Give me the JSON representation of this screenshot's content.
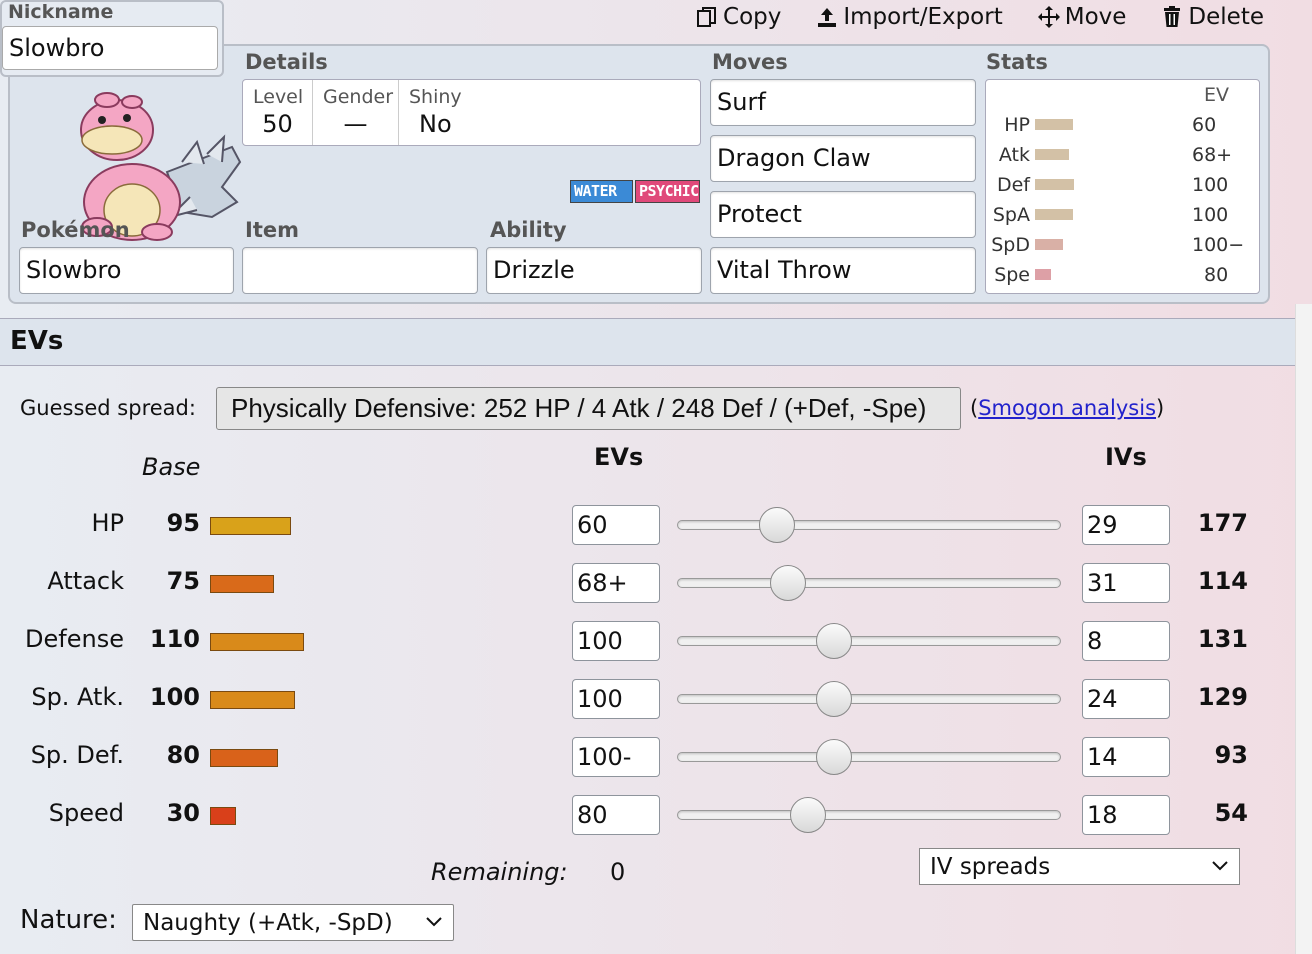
{
  "toolbar": {
    "copy": "Copy",
    "import_export": "Import/Export",
    "move": "Move",
    "delete": "Delete"
  },
  "nickname": {
    "label": "Nickname",
    "value": "Slowbro"
  },
  "sections": {
    "details": "Details",
    "moves": "Moves",
    "stats": "Stats",
    "pokemon": "Pokémon",
    "item": "Item",
    "ability": "Ability"
  },
  "details": {
    "level_label": "Level",
    "level": "50",
    "gender_label": "Gender",
    "gender": "—",
    "shiny_label": "Shiny",
    "shiny": "No"
  },
  "types": [
    "WATER",
    "PSYCHIC"
  ],
  "pokemon": "Slowbro",
  "item": "",
  "ability": "Drizzle",
  "moves": [
    "Surf",
    "Dragon Claw",
    "Protect",
    "Vital Throw"
  ],
  "stats_panel": {
    "ev_header": "EV",
    "rows": [
      {
        "name": "HP",
        "ev": "60"
      },
      {
        "name": "Atk",
        "ev": "68+"
      },
      {
        "name": "Def",
        "ev": "100"
      },
      {
        "name": "SpA",
        "ev": "100"
      },
      {
        "name": "SpD",
        "ev": "100−"
      },
      {
        "name": "Spe",
        "ev": "80"
      }
    ]
  },
  "evs_section": {
    "title": "EVs",
    "guessed_label": "Guessed spread:",
    "guessed_value": "Physically Defensive: 252 HP / 4 Atk / 248 Def / (+Def, -Spe)",
    "smogon_link": "Smogon analysis",
    "base_header": "Base",
    "evs_header": "EVs",
    "ivs_header": "IVs",
    "remaining_label": "Remaining:",
    "remaining_value": "0",
    "iv_spreads": "IV spreads",
    "nature_label": "Nature:",
    "nature_value": "Naughty (+Atk, -SpD)"
  },
  "stat_rows": [
    {
      "name": "HP",
      "base": "95",
      "ev": "60",
      "iv": "29",
      "total": "177",
      "bar_color": "#d9a21a",
      "slider_fraction": 0.26
    },
    {
      "name": "Attack",
      "base": "75",
      "ev": "68+",
      "iv": "31",
      "total": "114",
      "bar_color": "#d96a1a",
      "slider_fraction": 0.29
    },
    {
      "name": "Defense",
      "base": "110",
      "ev": "100",
      "iv": "8",
      "total": "131",
      "bar_color": "#d98a1a",
      "slider_fraction": 0.41
    },
    {
      "name": "Sp. Atk.",
      "base": "100",
      "ev": "100",
      "iv": "24",
      "total": "129",
      "bar_color": "#d98a1a",
      "slider_fraction": 0.41
    },
    {
      "name": "Sp. Def.",
      "base": "80",
      "ev": "100-",
      "iv": "14",
      "total": "93",
      "bar_color": "#d9621a",
      "slider_fraction": 0.41
    },
    {
      "name": "Speed",
      "base": "30",
      "ev": "80",
      "iv": "18",
      "total": "54",
      "bar_color": "#d9401a",
      "slider_fraction": 0.34
    }
  ]
}
